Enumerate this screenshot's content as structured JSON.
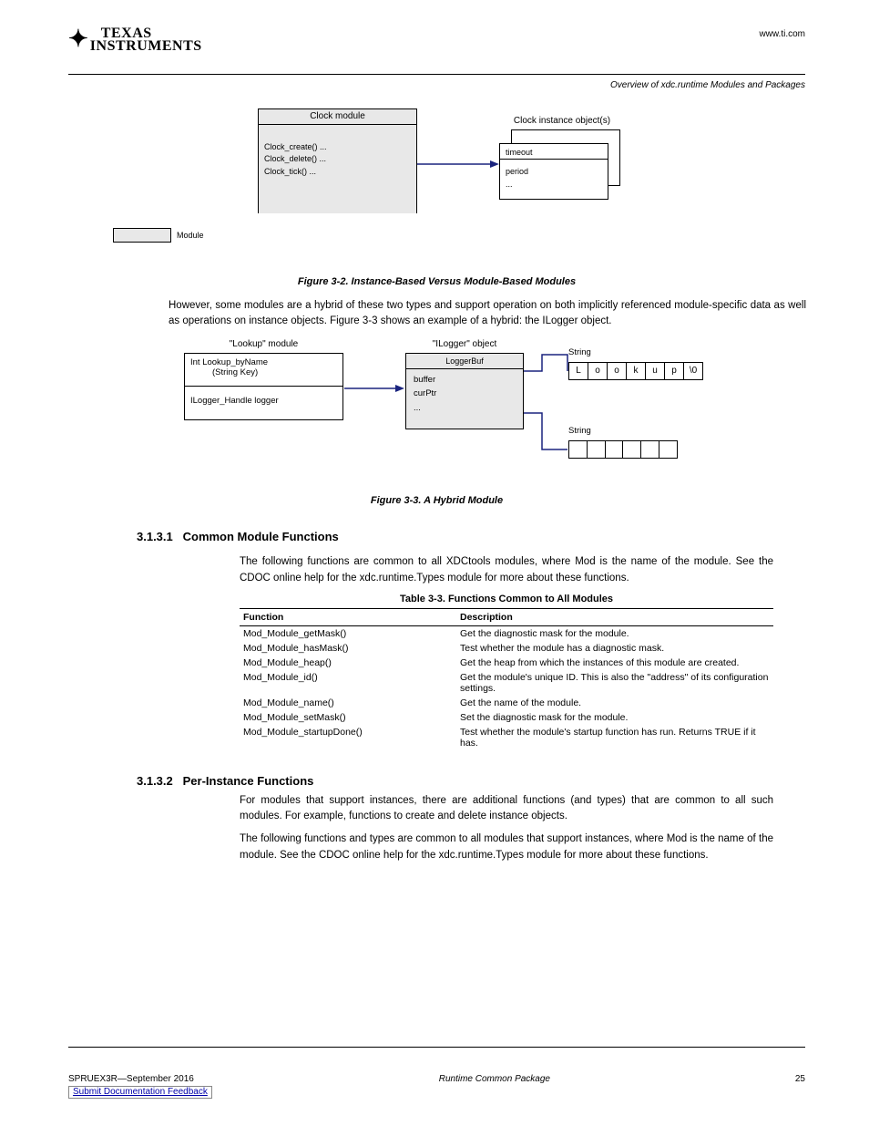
{
  "header": {
    "logo": {
      "line1": "TEXAS",
      "line2": "INSTRUMENTS"
    },
    "right_line1": "www.ti.com",
    "right_line2": "Overview of xdc.runtime Modules and Packages"
  },
  "figure32": {
    "moduleTitle": "Clock module",
    "moduleRows": [
      "Clock_create() ...",
      "Clock_delete() ...",
      "Clock_tick() ..."
    ],
    "instancesLabel": "Clock instance object(s)",
    "instanceRows": [
      "timeout",
      "period",
      "..."
    ],
    "legendLabel": "Module",
    "caption": "Figure 3-2. Instance-Based Versus Module-Based Modules"
  },
  "paragraph1": "However, some modules are a hybrid of these two types and support operation on both implicitly referenced module-specific data as well as operations on instance objects. Figure 3-3 shows an example of a hybrid: the ILogger object.",
  "figure33": {
    "lookupModuleTitle": "\"Lookup\" module",
    "lookupRow1a": "Int Lookup_byName",
    "lookupRow1b": "(String Key)",
    "lookupRow2": "ILogger_Handle logger",
    "iloggerTitle": "\"ILogger\" object",
    "iloggerModName": "LoggerBuf",
    "iloggerRows": [
      "buffer",
      "curPtr",
      "..."
    ],
    "strLabel": "String",
    "topChars": [
      "L",
      "o",
      "o",
      "k",
      "u",
      "p",
      "\\0"
    ],
    "botChars": [
      "",
      "",
      "",
      "",
      "",
      ""
    ],
    "caption": "Figure 3-3. A Hybrid Module"
  },
  "section": {
    "number": "3.1.3.1",
    "title": "Common Module Functions",
    "para": "The following functions are common to all XDCtools modules, where Mod is the name of the module. See the CDOC online help for the xdc.runtime.Types module for more about these functions.",
    "tableTitle": "Table 3-3. Functions Common to All Modules",
    "col1": "Function",
    "col2": "Description",
    "rows": [
      [
        "Mod_Module_getMask()",
        "Get the diagnostic mask for the module."
      ],
      [
        "Mod_Module_hasMask()",
        "Test whether the module has a diagnostic mask."
      ],
      [
        "Mod_Module_heap()",
        "Get the heap from which the instances of this module are created."
      ],
      [
        "Mod_Module_id()",
        "Get the module's unique ID. This is also the \"address\" of its configuration settings."
      ],
      [
        "Mod_Module_name()",
        "Get the name of the module."
      ],
      [
        "Mod_Module_setMask()",
        "Set the diagnostic mask for the module."
      ],
      [
        "Mod_Module_startupDone()",
        "Test whether the module's startup function has run. Returns TRUE if it has."
      ]
    ]
  },
  "section2": {
    "number": "3.1.3.2",
    "title": "Per-Instance Functions",
    "para1": "For modules that support instances, there are additional functions (and types) that are common to all such modules. For example, functions to create and delete instance objects.",
    "para2": "The following functions and types are common to all modules that support instances, where Mod is the name of the module. See the CDOC online help for the xdc.runtime.Types module for more about these functions."
  },
  "footer": {
    "left": "SPRUEX3R—September 2016",
    "mid": "Runtime Common Package",
    "right": "25",
    "feedbackLabel": "Submit Documentation Feedback"
  }
}
